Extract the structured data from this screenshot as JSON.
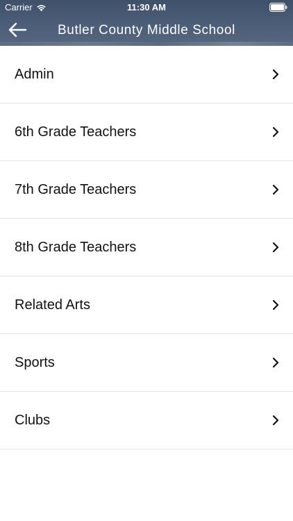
{
  "status_bar": {
    "carrier": "Carrier",
    "time": "11:30 AM",
    "icons": [
      "wifi-icon",
      "battery-icon"
    ]
  },
  "nav": {
    "title": "Butler County Middle School",
    "back_icon": "arrow-left-icon"
  },
  "list": {
    "items": [
      {
        "label": "Admin"
      },
      {
        "label": "6th Grade Teachers"
      },
      {
        "label": "7th Grade Teachers"
      },
      {
        "label": "8th Grade Teachers"
      },
      {
        "label": "Related Arts"
      },
      {
        "label": "Sports"
      },
      {
        "label": "Clubs"
      }
    ],
    "item_icon": "chevron-right-icon"
  },
  "colors": {
    "header": "#4a5c76",
    "background": "#ffffff",
    "divider": "#e3e3e3",
    "text": "#111111"
  }
}
